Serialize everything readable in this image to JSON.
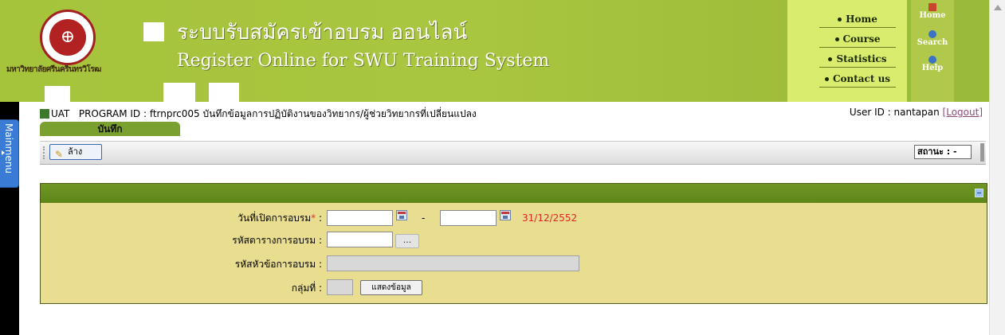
{
  "header": {
    "title_th": "ระบบรับสมัครเข้าอบรม ออนไลน์",
    "title_en": "Register Online for  SWU Training System",
    "university_name": "มหาวิทยาลัยศรีนครินทรวิโรฒ",
    "nav": [
      "Home",
      "Course",
      "Statistics",
      "Contact us"
    ],
    "icon_links": [
      {
        "label": "Home",
        "icon": "home-icon"
      },
      {
        "label": "Search",
        "icon": "search-icon"
      },
      {
        "label": "Help",
        "icon": "help-icon"
      }
    ],
    "colors": {
      "band": "#a6c33c",
      "nav_box": "#d9ec6d"
    }
  },
  "mainmenu": {
    "label": "Mainmenu"
  },
  "program": {
    "env": "UAT",
    "line": "PROGRAM ID : ftrnprc005 บันทึกข้อมูลการปฏิบัติงานของวิทยากร/ผู้ช่วยวิทยากรที่เปลี่ยนแปลง"
  },
  "user": {
    "label": "User ID : nantapan ",
    "logout": "[Logout]"
  },
  "tab": {
    "label": "บันทึก"
  },
  "toolbar": {
    "clear_label": "ล้าง",
    "status_label": "สถานะ : -"
  },
  "form": {
    "open_date_label": "วันที่เปิดการอบรม",
    "required_mark": "*",
    "colon": " :",
    "date_separator": "-",
    "end_date_hint": "31/12/2552",
    "schedule_code_label": "รหัสตารางการอบรม :",
    "lookup_button": "...",
    "topic_code_label": "รหัสหัวข้อการอบรม :",
    "group_label": "กลุ่มที่ :",
    "show_button": "แสดงข้อมูล",
    "colors": {
      "panel_head": "#6f9624",
      "panel_body": "#e9dd90",
      "hint": "#e02424"
    }
  }
}
